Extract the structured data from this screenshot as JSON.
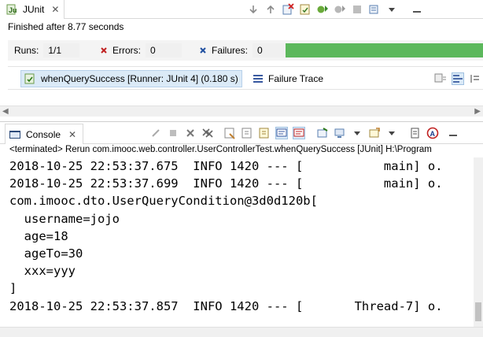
{
  "junit": {
    "tab_label": "JUnit",
    "status": "Finished after 8.77 seconds",
    "runs_label": "Runs:",
    "runs_value": "1/1",
    "errors_label": "Errors:",
    "errors_value": "0",
    "failures_label": "Failures:",
    "failures_value": "0",
    "progress": 1.0,
    "progress_color": "#5cb85c",
    "test_tab": "whenQuerySuccess [Runner: JUnit 4] (0.180 s)",
    "failure_trace": "Failure Trace"
  },
  "console": {
    "tab_label": "Console",
    "terminated": "<terminated> Rerun com.imooc.web.controller.UserControllerTest.whenQuerySuccess [JUnit] H:\\Program",
    "lines": [
      "2018-10-25 22:53:37.675  INFO 1420 --- [           main] o.",
      "2018-10-25 22:53:37.699  INFO 1420 --- [           main] o.",
      "com.imooc.dto.UserQueryCondition@3d0d120b[",
      "  username=jojo",
      "  age=18",
      "  ageTo=30",
      "  xxx=yyy",
      "]",
      "2018-10-25 22:53:37.857  INFO 1420 --- [       Thread-7] o."
    ]
  }
}
